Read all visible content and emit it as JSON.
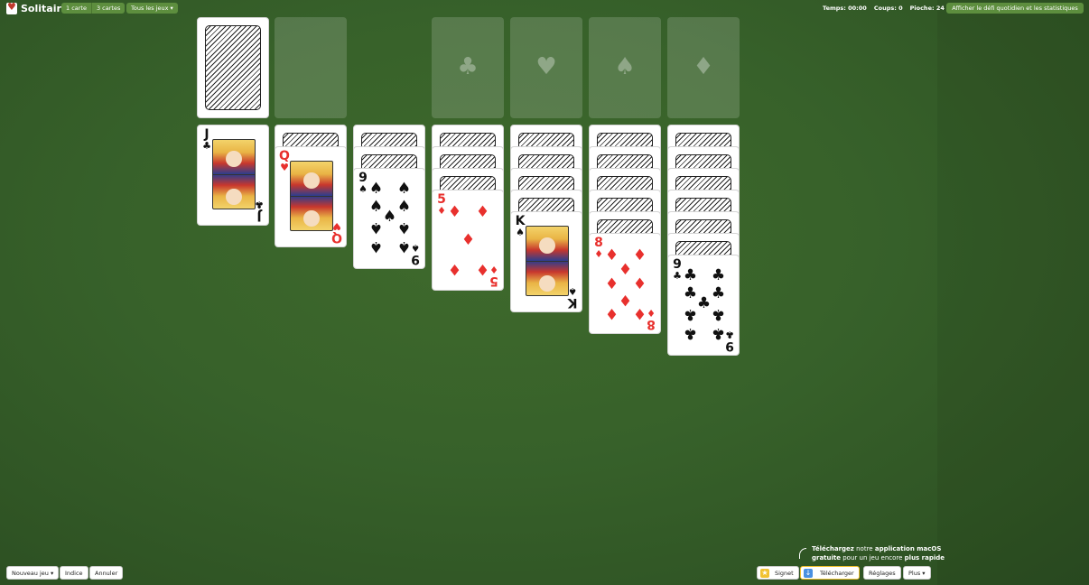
{
  "header": {
    "title": "Solitaire",
    "draw_modes": [
      "1 carte",
      "3 cartes"
    ],
    "all_games_label": "Tous les jeux ▾",
    "stats": {
      "time_label": "Temps:",
      "time_value": "00:00",
      "moves_label": "Coups:",
      "moves_value": "0",
      "stock_label": "Pioche:",
      "stock_value": "24"
    },
    "daily_label": "Afficher le défi quotidien et les statistiques"
  },
  "foundations": {
    "suits": [
      "♣",
      "♥",
      "♠",
      "♦"
    ]
  },
  "tableau": {
    "columns": [
      {
        "hidden": 0,
        "face_up": [
          {
            "rank": "J",
            "suit": "♣",
            "color": "black"
          }
        ]
      },
      {
        "hidden": 1,
        "face_up": [
          {
            "rank": "Q",
            "suit": "♥",
            "color": "red"
          }
        ]
      },
      {
        "hidden": 2,
        "face_up": [
          {
            "rank": "9",
            "suit": "♠",
            "color": "black"
          }
        ]
      },
      {
        "hidden": 3,
        "face_up": [
          {
            "rank": "5",
            "suit": "♦",
            "color": "red"
          }
        ]
      },
      {
        "hidden": 4,
        "face_up": [
          {
            "rank": "K",
            "suit": "♠",
            "color": "black"
          }
        ]
      },
      {
        "hidden": 5,
        "face_up": [
          {
            "rank": "8",
            "suit": "♦",
            "color": "red"
          }
        ]
      },
      {
        "hidden": 6,
        "face_up": [
          {
            "rank": "9",
            "suit": "♣",
            "color": "black"
          }
        ]
      }
    ]
  },
  "footer": {
    "new_game_label": "Nouveau jeu ▾",
    "hint_label": "Indice",
    "undo_label": "Annuler",
    "bookmark_label": "Signet",
    "download_label": "Télécharger",
    "settings_label": "Réglages",
    "more_label": "Plus ▾",
    "promo": {
      "line1_bold": "Téléchargez",
      "line1_mid": " notre ",
      "line1_bold2": "application macOS",
      "line2_bold": "gratuite",
      "line2_mid": " pour un jeu encore ",
      "line2_bold2": "plus rapide"
    }
  },
  "colors": {
    "felt": "#37612a",
    "button_green": "#5d8e3e",
    "red_suit": "#e8302d",
    "black_suit": "#111111"
  }
}
